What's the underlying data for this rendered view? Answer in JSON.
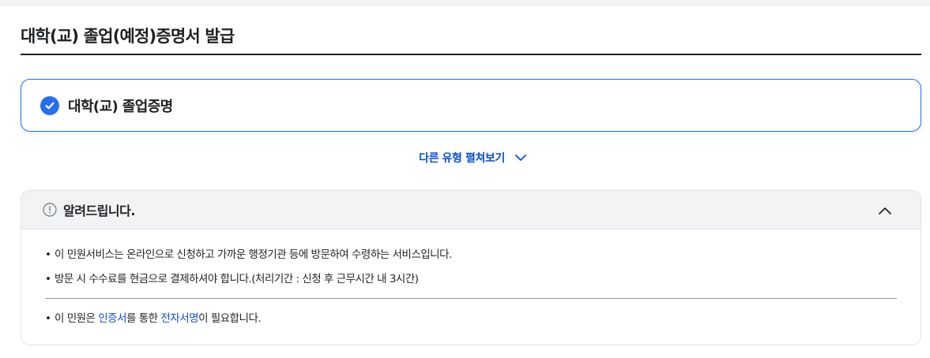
{
  "page": {
    "title": "대학(교) 졸업(예정)증명서 발급"
  },
  "selected_type": {
    "label": "대학(교) 졸업증명",
    "icon": "check-circle-icon",
    "accent": "#256ef4"
  },
  "expand": {
    "label": "다른 유형 펼쳐보기",
    "icon": "chevron-down-icon"
  },
  "notice": {
    "title": "알려드립니다.",
    "icon": "exclamation-circle-icon",
    "collapse_icon": "chevron-up-icon",
    "items": [
      "이 민원서비스는 온라인으로 신청하고 가까운 행정기관 등에 방문하여 수령하는 서비스입니다.",
      "방문 시 수수료를 현금으로 결제하셔야 합니다.(처리기간 : 신청 후 근무시간 내 3시간)"
    ],
    "cert_note": {
      "prefix": "이 민원은 ",
      "cert_link": "인증서",
      "middle": "를 통한 ",
      "sign_link": "전자서명",
      "suffix": "이 필요합니다."
    }
  }
}
